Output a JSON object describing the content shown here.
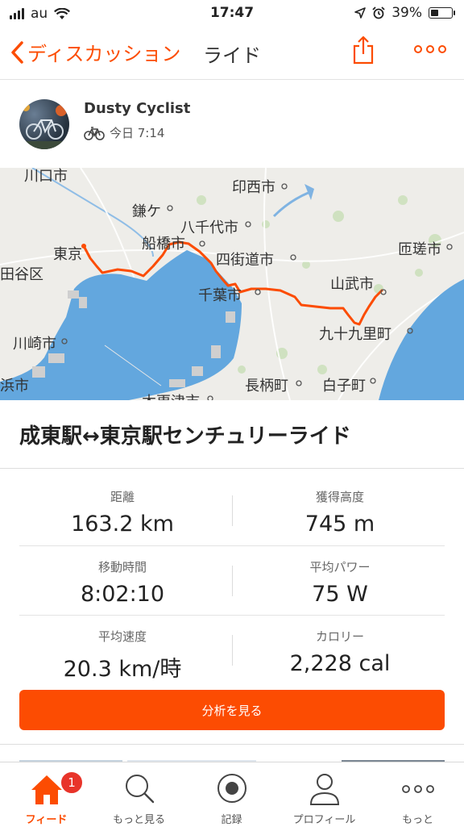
{
  "status_bar": {
    "carrier": "au",
    "time": "17:47",
    "battery_percent": "39%",
    "battery_level": 0.39
  },
  "nav": {
    "back_label": "ディスカッション",
    "title": "ライド"
  },
  "athlete": {
    "name": "Dusty Cyclist",
    "timestamp": "今日 7:14"
  },
  "map": {
    "labels": [
      "川口市",
      "鎌ケ",
      "印西市",
      "八千代市",
      "船橋市",
      "東京",
      "田谷区",
      "四街道市",
      "匝瑳市",
      "山武市",
      "千葉市",
      "九十九里町",
      "川崎市",
      "浜市",
      "長柄町",
      "白子町",
      "木更津市"
    ],
    "route_color": "#fc4c02"
  },
  "activity": {
    "title": "成東駅↔東京駅センチュリーライド"
  },
  "stats": [
    {
      "label": "距離",
      "value": "163.2 km"
    },
    {
      "label": "獲得高度",
      "value": "745 m"
    },
    {
      "label": "移動時間",
      "value": "8:02:10"
    },
    {
      "label": "平均パワー",
      "value": "75 W"
    },
    {
      "label": "平均速度",
      "value": "20.3 km/時"
    },
    {
      "label": "カロリー",
      "value": "2,228 cal"
    }
  ],
  "analyze_button": "分析を見る",
  "tabs": [
    {
      "label": "フィード",
      "icon": "home-icon",
      "badge": "1"
    },
    {
      "label": "もっと見る",
      "icon": "search-icon"
    },
    {
      "label": "記録",
      "icon": "record-icon"
    },
    {
      "label": "プロフィール",
      "icon": "profile-icon"
    },
    {
      "label": "もっと",
      "icon": "more-icon"
    }
  ],
  "colors": {
    "accent": "#fc4c02",
    "water": "#63a7de",
    "land": "#eeede9",
    "badge": "#e8342a"
  }
}
